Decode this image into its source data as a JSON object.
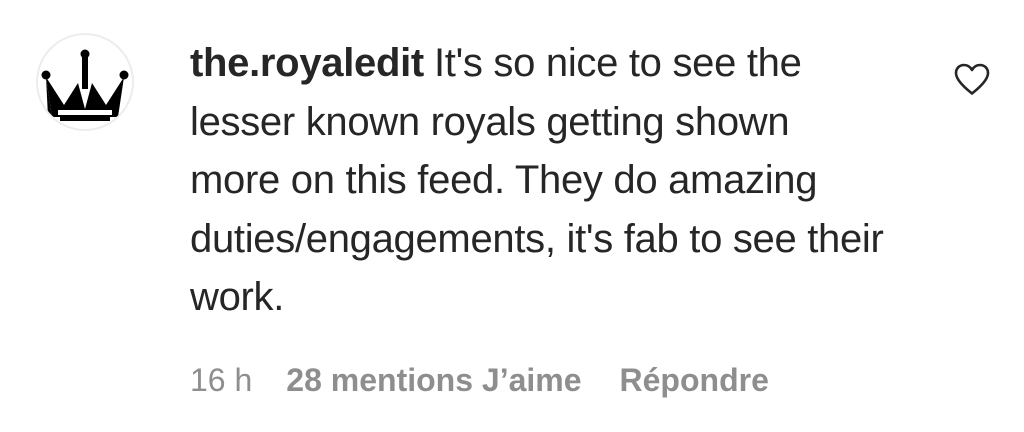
{
  "comment": {
    "username": "the.royaledit",
    "text": "It's so nice to see the lesser known royals getting shown more on this feed. They do amazing duties/engagements, it's fab to see their work.",
    "avatar_icon": "crown-icon",
    "like_icon": "heart-outline-icon"
  },
  "meta": {
    "timestamp": "16 h",
    "likes": "28 mentions J’aime",
    "reply": "Répondre"
  },
  "colors": {
    "text": "#262626",
    "secondary": "#8e8e8e",
    "avatar_border": "#ececec"
  }
}
